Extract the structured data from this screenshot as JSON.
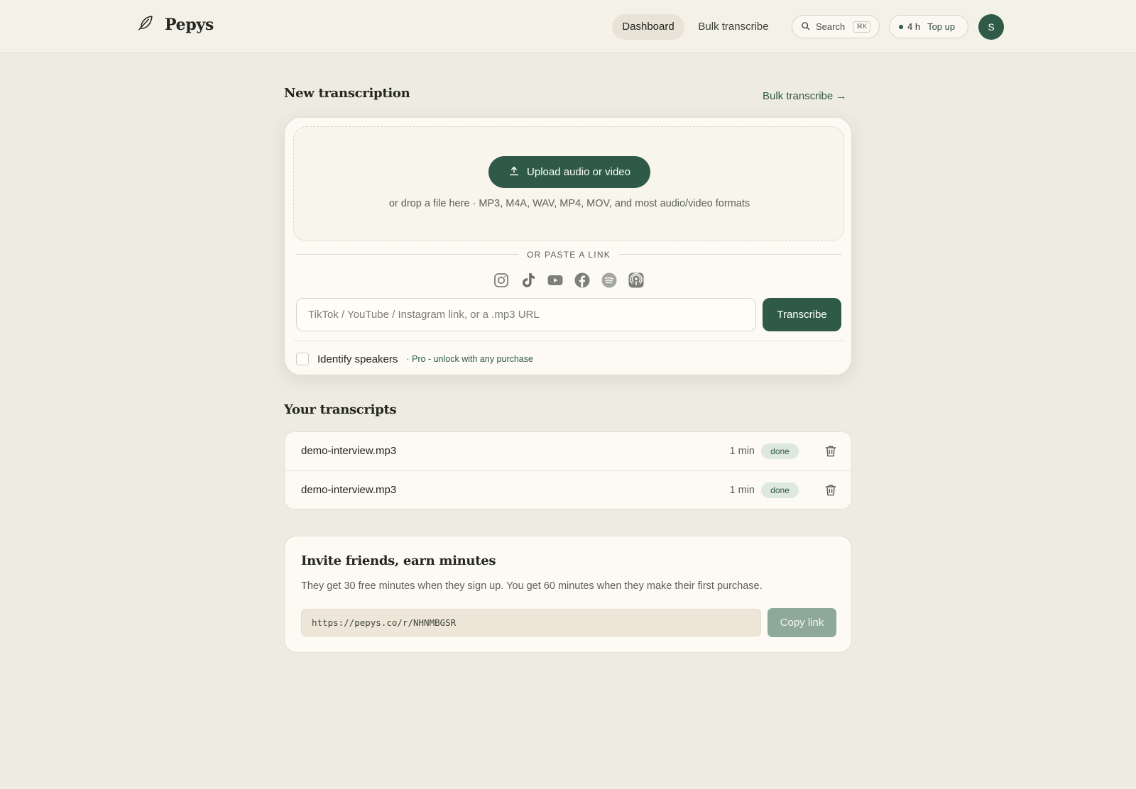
{
  "app": {
    "name": "Pepys",
    "brand_color": "#2f5a47",
    "logo_icon": "feather-icon"
  },
  "nav": {
    "dashboard": "Dashboard",
    "bulk": "Bulk transcribe",
    "search_label": "Search",
    "search_shortcut": "⌘K",
    "credits": "4 h",
    "topup": "Top up",
    "avatar_initial": "S"
  },
  "new_transcription": {
    "title": "New transcription",
    "bulk_link": "Bulk transcribe →",
    "upload_button": "Upload audio or video",
    "drop_hint": "or drop a file here · MP3, M4A, WAV, MP4, MOV, and most audio/video formats",
    "divider": "OR PASTE A LINK",
    "platforms": [
      "instagram-icon",
      "tiktok-icon",
      "youtube-icon",
      "facebook-icon",
      "spotify-icon",
      "podcasts-icon"
    ],
    "link_placeholder": "TikTok / YouTube / Instagram link, or a .mp3 URL",
    "transcribe_button": "Transcribe",
    "identify_speakers": "Identify speakers",
    "pro_note": "· Pro - unlock with any purchase"
  },
  "transcripts": {
    "title": "Your transcripts",
    "rows": [
      {
        "name": "demo-interview.mp3",
        "duration": "1 min",
        "status": "done"
      },
      {
        "name": "demo-interview.mp3",
        "duration": "1 min",
        "status": "done"
      }
    ]
  },
  "invite": {
    "title": "Invite friends, earn minutes",
    "description": "They get 30 free minutes when they sign up. You get 60 minutes when they make their first purchase.",
    "link": "https://pepys.co/r/NHNMBGSR",
    "copy_button": "Copy link"
  }
}
